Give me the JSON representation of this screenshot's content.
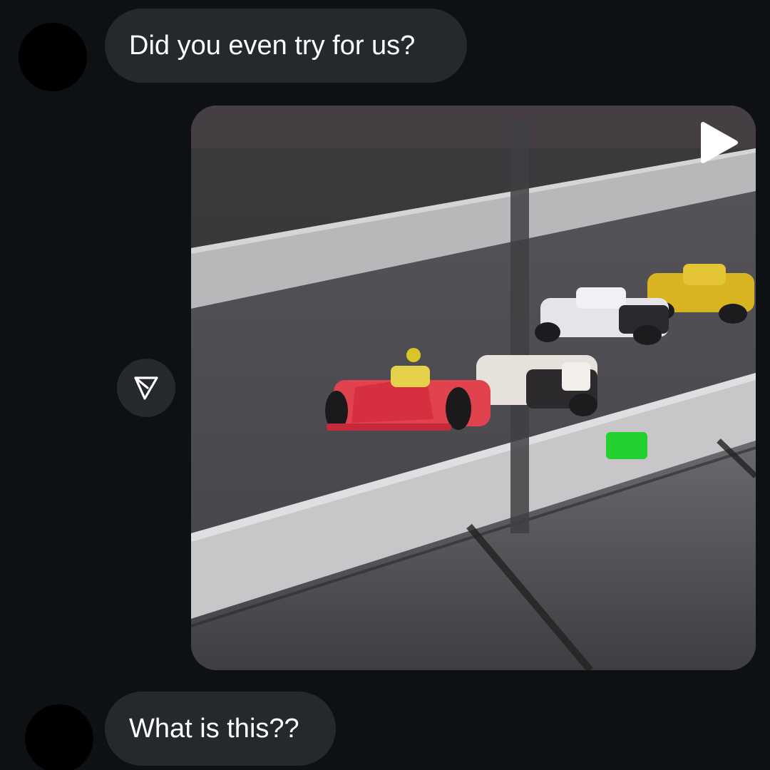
{
  "messages": [
    {
      "sender": "other",
      "text": "Did you even try for us?"
    },
    {
      "sender": "other",
      "type": "video"
    },
    {
      "sender": "other",
      "text": "What is this??"
    }
  ],
  "icons": {
    "share": "send-icon",
    "video": "play-icon"
  },
  "colors": {
    "background": "#0e1114",
    "bubble": "#25282c",
    "text": "#ffffff",
    "avatar": "#000000"
  }
}
